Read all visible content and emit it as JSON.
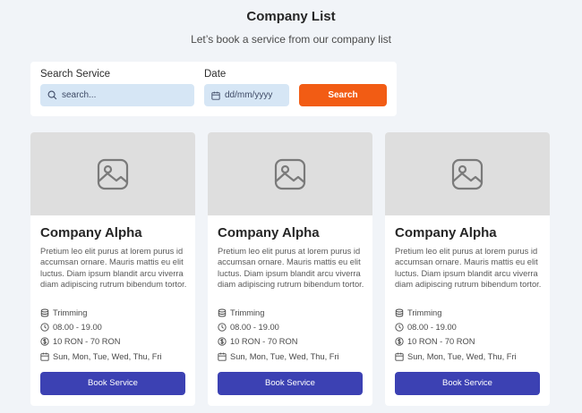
{
  "header": {
    "title": "Company List",
    "subtitle": "Let’s book a service from our company list"
  },
  "search": {
    "service_label": "Search Service",
    "service_placeholder": "search...",
    "date_label": "Date",
    "date_placeholder": "dd/mm/yyyy",
    "button_label": "Search"
  },
  "colors": {
    "background": "#f1f4f8",
    "search_button": "#f25c14",
    "book_button": "#3c41b3",
    "input_bg": "#d6e6f5",
    "image_placeholder": "#dedede"
  },
  "cards": [
    {
      "title": "Company Alpha",
      "description": "Pretium leo elit purus at lorem purus id accumsan ornare. Mauris mattis eu elit luctus. Diam ipsum blandit arcu viverra diam adipiscing rutrum bibendum tortor.",
      "service": "Trimming",
      "hours": "08.00 - 19.00",
      "price": "10 RON - 70 RON",
      "days": "Sun, Mon, Tue, Wed, Thu, Fri",
      "button_label": "Book Service"
    },
    {
      "title": "Company Alpha",
      "description": "Pretium leo elit purus at lorem purus id accumsan ornare. Mauris mattis eu elit luctus. Diam ipsum blandit arcu viverra diam adipiscing rutrum bibendum tortor.",
      "service": "Trimming",
      "hours": "08.00 - 19.00",
      "price": "10 RON - 70 RON",
      "days": "Sun, Mon, Tue, Wed, Thu, Fri",
      "button_label": "Book Service"
    },
    {
      "title": "Company Alpha",
      "description": "Pretium leo elit purus at lorem purus id accumsan ornare. Mauris mattis eu elit luctus. Diam ipsum blandit arcu viverra diam adipiscing rutrum bibendum tortor.",
      "service": "Trimming",
      "hours": "08.00 - 19.00",
      "price": "10 RON - 70 RON",
      "days": "Sun, Mon, Tue, Wed, Thu, Fri",
      "button_label": "Book Service"
    }
  ],
  "icons": {
    "search": "search-icon",
    "date": "calendar-icon",
    "image": "image-placeholder-icon",
    "service": "service-icon",
    "hours": "clock-icon",
    "price": "dollar-icon",
    "days": "calendar-icon"
  }
}
